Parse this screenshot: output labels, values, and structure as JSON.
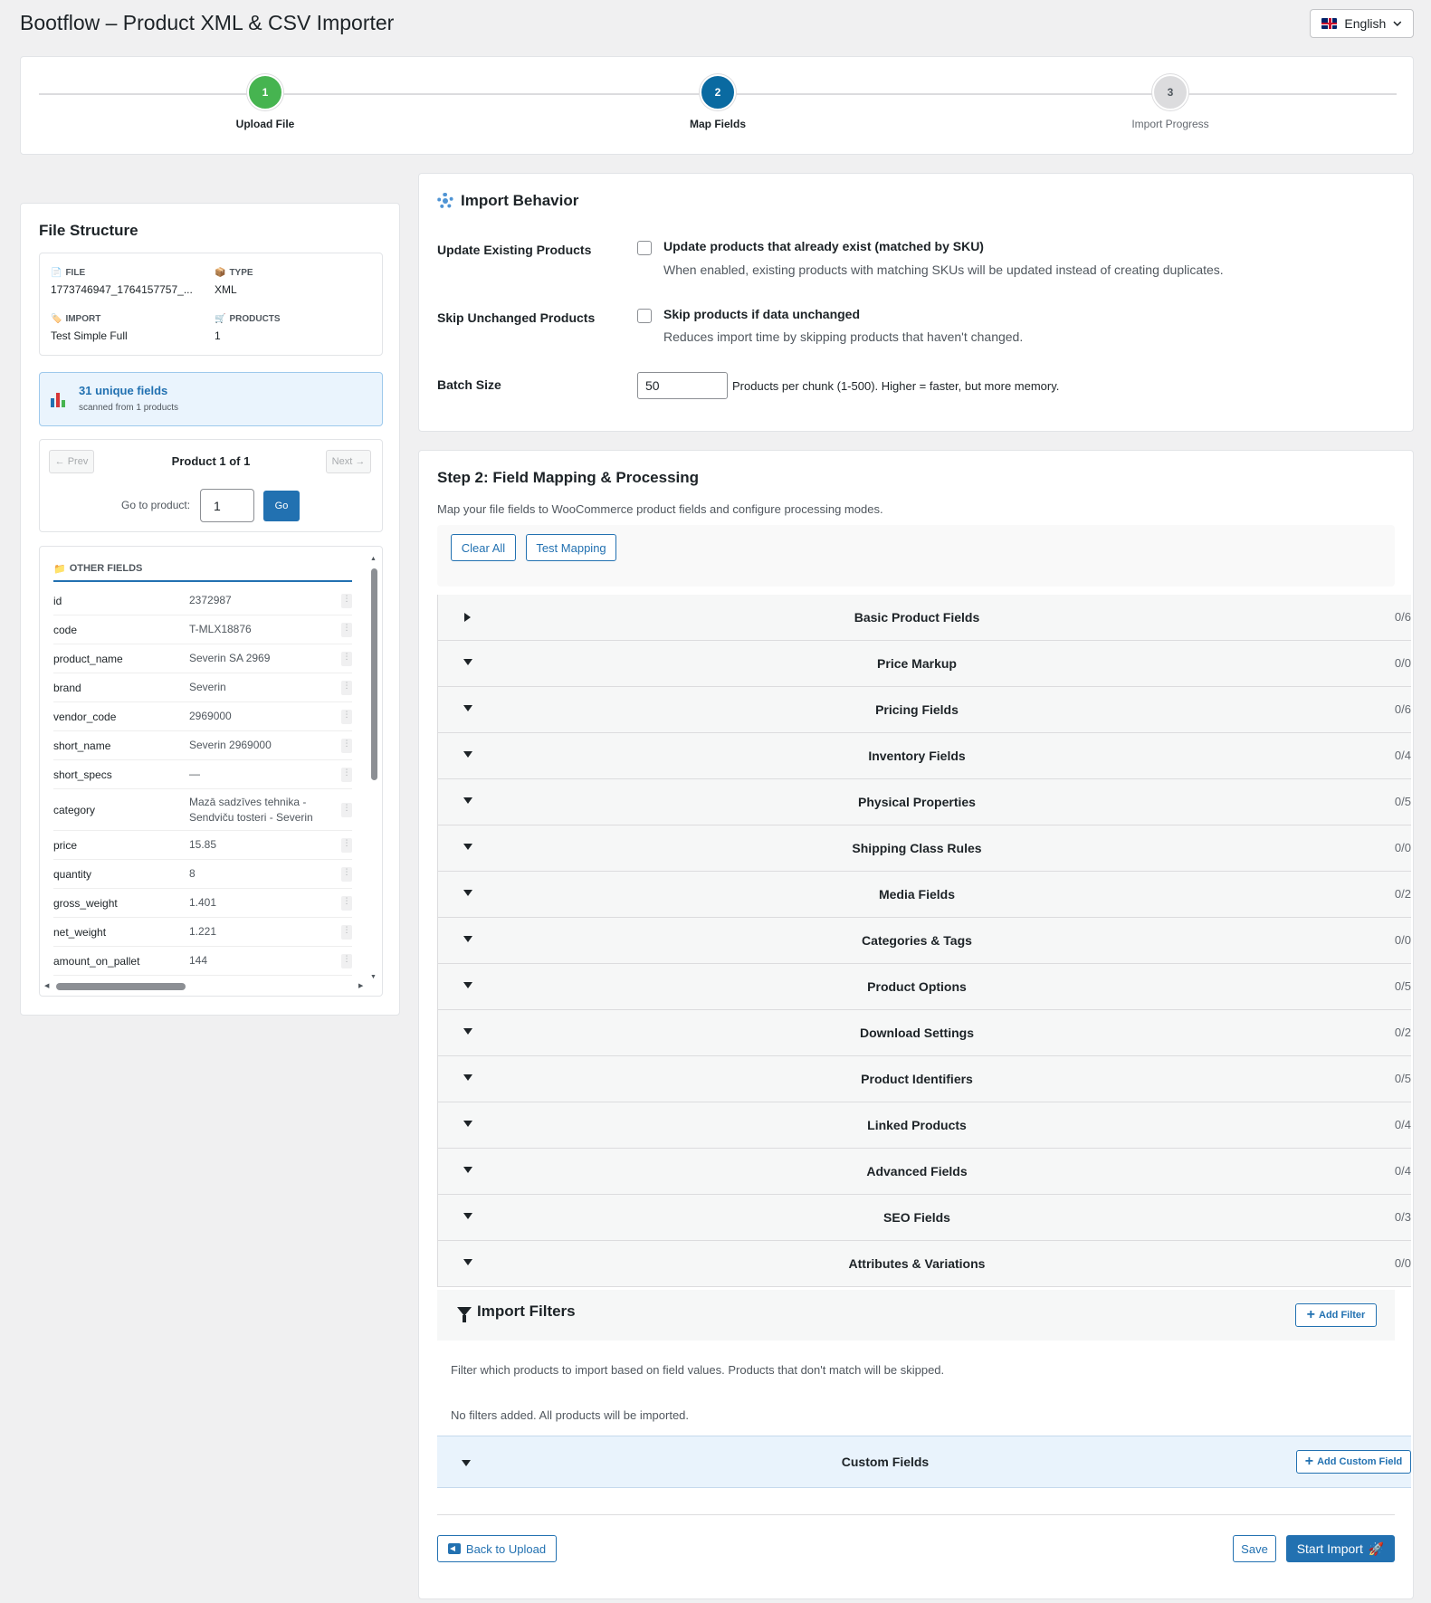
{
  "app": {
    "title": "Bootflow – Product XML & CSV Importer"
  },
  "language": {
    "selected": "English",
    "icon": "uk-flag-icon"
  },
  "steps": [
    {
      "num": "1",
      "label": "Upload File",
      "state": "done"
    },
    {
      "num": "2",
      "label": "Map Fields",
      "state": "active"
    },
    {
      "num": "3",
      "label": "Import Progress",
      "state": "pending"
    }
  ],
  "file_structure": {
    "title": "File Structure",
    "file_label": "FILE",
    "file_value": "1773746947_1764157757_...",
    "type_label": "TYPE",
    "type_value": "XML",
    "import_label": "IMPORT",
    "import_value": "Test Simple Full",
    "products_label": "PRODUCTS",
    "products_value": "1",
    "unique_fields": "31 unique fields",
    "scanned": "scanned from 1 products",
    "prev_label": "← Prev",
    "next_label": "Next →",
    "product_nav": "Product 1 of 1",
    "goto_label": "Go to product:",
    "goto_value": "1",
    "go_label": "Go",
    "other_fields_label": "OTHER FIELDS",
    "fields": [
      {
        "key": "id",
        "value": "2372987"
      },
      {
        "key": "code",
        "value": "T-MLX18876"
      },
      {
        "key": "product_name",
        "value": "Severin SA 2969"
      },
      {
        "key": "brand",
        "value": "Severin"
      },
      {
        "key": "vendor_code",
        "value": "2969000"
      },
      {
        "key": "short_name",
        "value": "Severin 2969000"
      },
      {
        "key": "short_specs",
        "value": "—"
      },
      {
        "key": "category",
        "value": "Mazā sadzīves tehnika - Sendviču tosteri - Severin"
      },
      {
        "key": "price",
        "value": "15.85"
      },
      {
        "key": "quantity",
        "value": "8"
      },
      {
        "key": "gross_weight",
        "value": "1.401"
      },
      {
        "key": "net_weight",
        "value": "1.221"
      },
      {
        "key": "amount_on_pallet",
        "value": "144"
      }
    ]
  },
  "behavior": {
    "title": "Import Behavior",
    "update_label": "Update Existing Products",
    "update_cb": "Update products that already exist (matched by SKU)",
    "update_desc": "When enabled, existing products with matching SKUs will be updated instead of creating duplicates.",
    "skip_label": "Skip Unchanged Products",
    "skip_cb": "Skip products if data unchanged",
    "skip_desc": "Reduces import time by skipping products that haven't changed.",
    "batch_label": "Batch Size",
    "batch_value": "50",
    "batch_help": "Products per chunk (1-500). Higher = faster, but more memory."
  },
  "mapping": {
    "title": "Step 2: Field Mapping & Processing",
    "desc": "Map your file fields to WooCommerce product fields and configure processing modes.",
    "clear_all": "Clear All",
    "test_mapping": "Test Mapping",
    "sections": [
      {
        "name": "Basic Product Fields",
        "count": "0/6",
        "collapsed": true
      },
      {
        "name": "Price Markup",
        "count": "0/0"
      },
      {
        "name": "Pricing Fields",
        "count": "0/6"
      },
      {
        "name": "Inventory Fields",
        "count": "0/4"
      },
      {
        "name": "Physical Properties",
        "count": "0/5"
      },
      {
        "name": "Shipping Class Rules",
        "count": "0/0"
      },
      {
        "name": "Media Fields",
        "count": "0/2"
      },
      {
        "name": "Categories & Tags",
        "count": "0/0"
      },
      {
        "name": "Product Options",
        "count": "0/5"
      },
      {
        "name": "Download Settings",
        "count": "0/2"
      },
      {
        "name": "Product Identifiers",
        "count": "0/5"
      },
      {
        "name": "Linked Products",
        "count": "0/4"
      },
      {
        "name": "Advanced Fields",
        "count": "0/4"
      },
      {
        "name": "SEO Fields",
        "count": "0/3"
      },
      {
        "name": "Attributes & Variations",
        "count": "0/0"
      }
    ],
    "filters_title": "Import Filters",
    "add_filter": "Add Filter",
    "filters_desc": "Filter which products to import based on field values. Products that don't match will be skipped.",
    "filters_empty": "No filters added. All products will be imported.",
    "custom_fields": "Custom Fields",
    "add_custom_field": "Add Custom Field",
    "back": "Back to Upload",
    "save": "Save",
    "start": "Start Import",
    "start_icon": "🚀"
  }
}
